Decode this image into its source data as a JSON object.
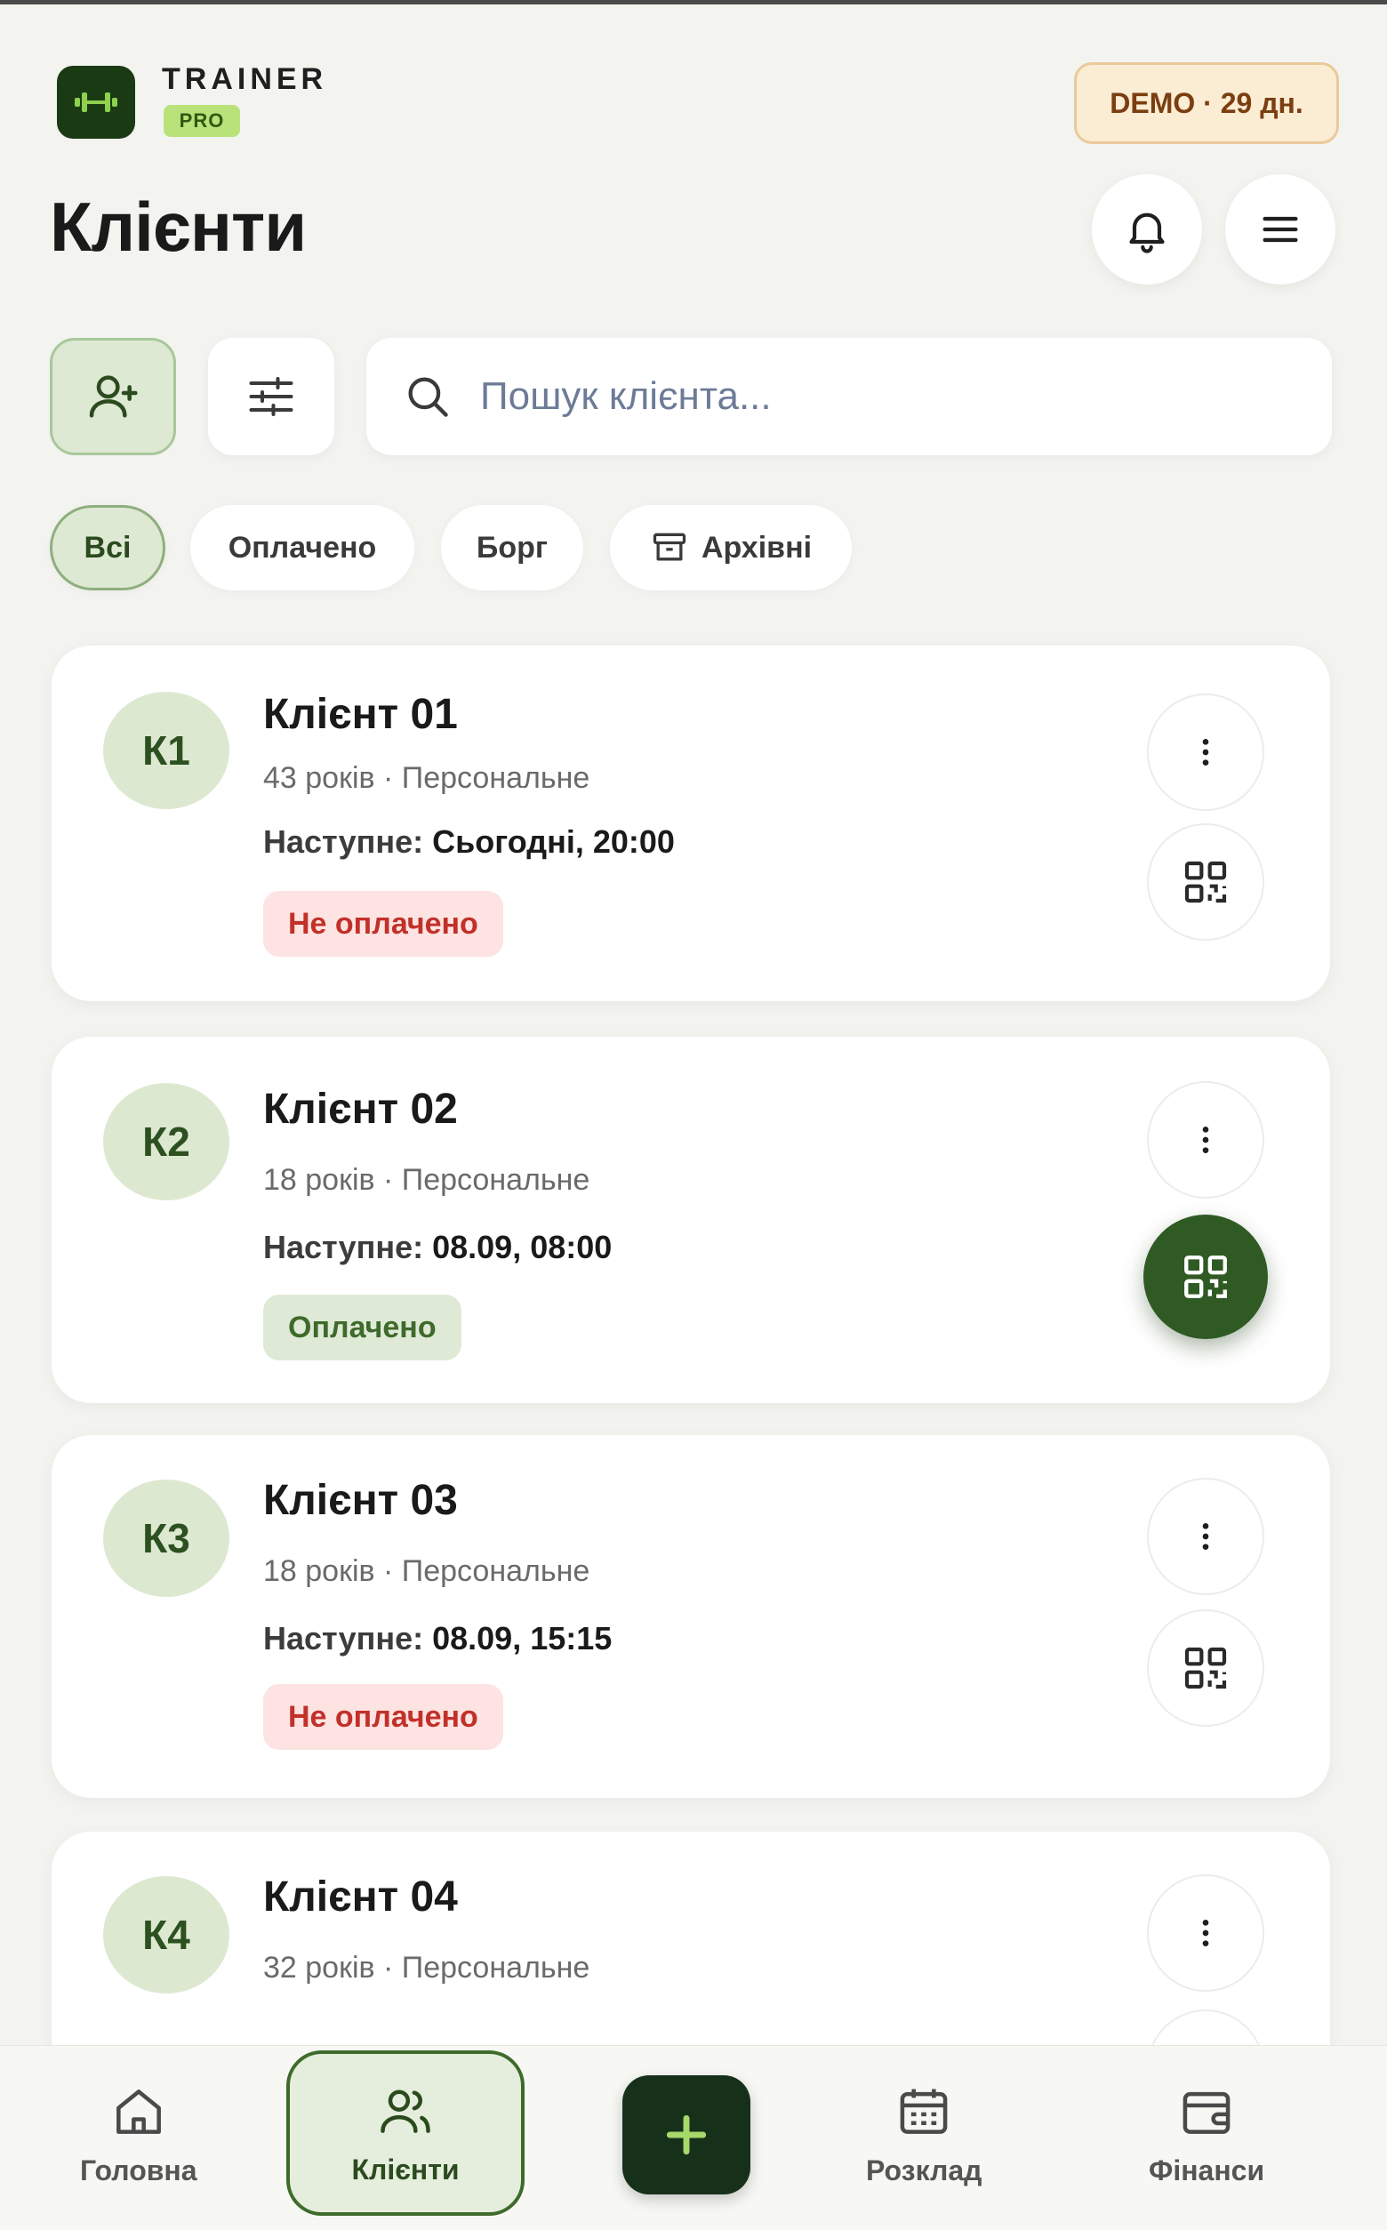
{
  "brand": {
    "name": "TRAINER",
    "tier": "PRO"
  },
  "demo_badge": "DEMO · 29 дн.",
  "page_title": "Клієнти",
  "search": {
    "placeholder": "Пошук клієнта..."
  },
  "filters": [
    {
      "label": "Всі",
      "active": true
    },
    {
      "label": "Оплачено",
      "active": false
    },
    {
      "label": "Борг",
      "active": false
    },
    {
      "label": "Архівні",
      "active": false,
      "icon": "archive-icon"
    }
  ],
  "clients": [
    {
      "initials": "К1",
      "name": "Клієнт 01",
      "subtitle": "43 років · Персональне",
      "next_label": "Наступне:",
      "next_value": "Сьогодні, 20:00",
      "status": "Не оплачено",
      "status_type": "unpaid"
    },
    {
      "initials": "К2",
      "name": "Клієнт 02",
      "subtitle": "18 років · Персональне",
      "next_label": "Наступне:",
      "next_value": "08.09, 08:00",
      "status": "Оплачено",
      "status_type": "paid"
    },
    {
      "initials": "К3",
      "name": "Клієнт 03",
      "subtitle": "18 років · Персональне",
      "next_label": "Наступне:",
      "next_value": "08.09, 15:15",
      "status": "Не оплачено",
      "status_type": "unpaid"
    },
    {
      "initials": "К4",
      "name": "Клієнт 04",
      "subtitle": "32 років · Персональне"
    }
  ],
  "bottom_nav": {
    "home": "Головна",
    "clients": "Клієнти",
    "schedule": "Розклад",
    "finance": "Фінанси"
  },
  "colors": {
    "accent_dark": "#2f5a24",
    "accent_light": "#dde9d3",
    "unpaid": "#c2302a",
    "paid": "#3e6a2b",
    "demo": "#7a3e10"
  }
}
